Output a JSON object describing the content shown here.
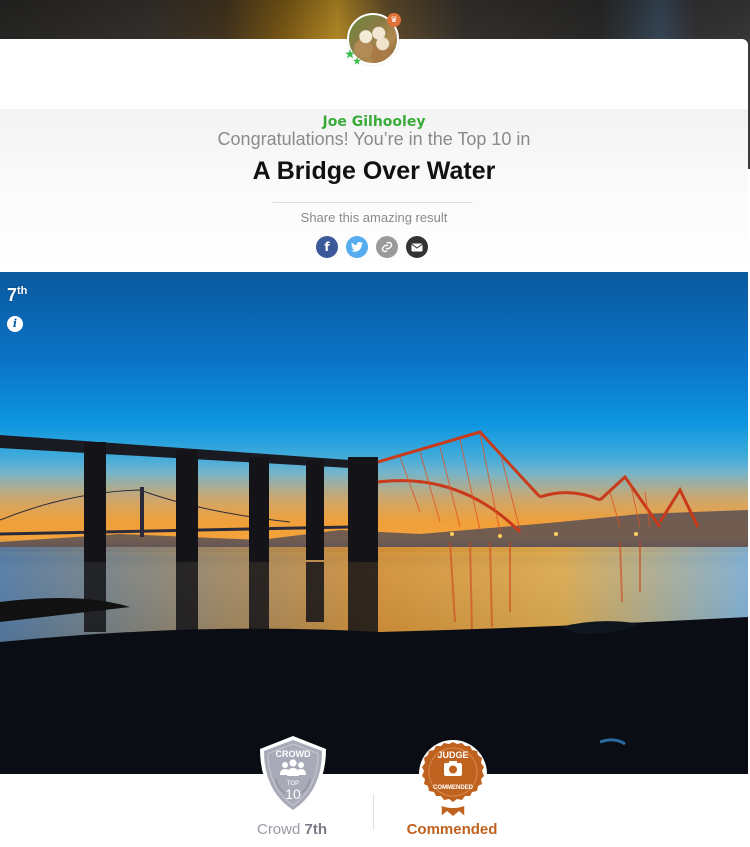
{
  "profile": {
    "username": "Joe Gilhooley",
    "avatar_alt": "owls-avatar",
    "crown_badge": "♛"
  },
  "result": {
    "congrats_text": "Congratulations! You’re in the Top 10 in",
    "contest_title": "A Bridge Over Water",
    "share_label": "Share this amazing result",
    "share_buttons": [
      {
        "name": "facebook",
        "glyph": "f",
        "color": "#3b5998"
      },
      {
        "name": "twitter",
        "glyph": "t",
        "color": "#55acee"
      },
      {
        "name": "copy-link",
        "glyph": "🔗",
        "color": "#9a9a9a"
      },
      {
        "name": "email",
        "glyph": "✉",
        "color": "#333333"
      }
    ]
  },
  "photo": {
    "rank_number": "7",
    "rank_suffix": "th",
    "info_glyph": "i",
    "subject": "Forth Bridge at sunset"
  },
  "badges": {
    "crowd": {
      "top_text": "CROWD",
      "middle_text": "TOP",
      "number": "10",
      "label_prefix": "Crowd",
      "label_value": "7th",
      "color": "#a9aab8"
    },
    "judge": {
      "top_text": "JUDGE",
      "bottom_text": "COMMENDED",
      "label": "Commended",
      "color": "#c0621f"
    }
  },
  "colors": {
    "username": "#3aaa3a",
    "judge_accent": "#c0621f",
    "crowd_accent": "#a9aab8"
  }
}
